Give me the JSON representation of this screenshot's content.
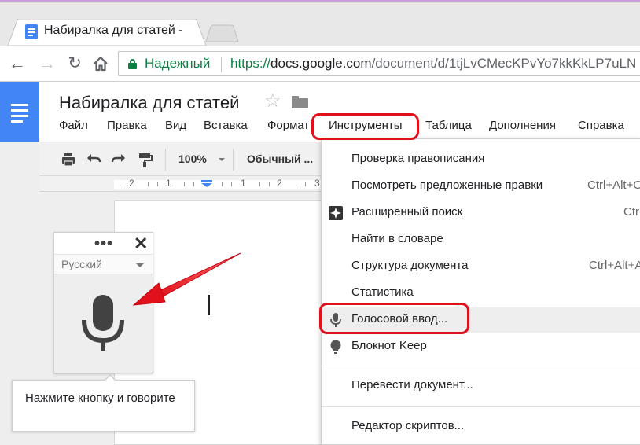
{
  "browser": {
    "tab_title": "Набиралка для статей -",
    "security_label": "Надежный",
    "url_scheme": "https://",
    "url_host": "docs.google.com",
    "url_path": "/document/d/1tjLvCMecKPvYo7kkKkLP7uLN"
  },
  "docs": {
    "title": "Набиралка для статей",
    "menu": [
      "Файл",
      "Правка",
      "Вид",
      "Вставка",
      "Формат",
      "Инструменты",
      "Таблица",
      "Дополнения",
      "Справка"
    ],
    "toolbar": {
      "zoom": "100%",
      "style": "Обычный ..."
    },
    "ruler": [
      "2",
      "1",
      "1",
      "2",
      "3"
    ]
  },
  "voice_widget": {
    "dots": "•••",
    "close": "✕",
    "language": "Русский",
    "hint": "Нажмите кнопку и говорите"
  },
  "tools_menu": {
    "items": [
      {
        "label": "Проверка правописания",
        "shortcut": "",
        "icon": ""
      },
      {
        "label": "Посмотреть предложенные правки",
        "shortcut": "Ctrl+Alt+O",
        "icon": ""
      },
      {
        "label": "Расширенный поиск",
        "shortcut": "Ctrl",
        "icon": "explore-icon"
      },
      {
        "label": "Найти в словаре",
        "shortcut": "",
        "icon": ""
      },
      {
        "label": "Структура документа",
        "shortcut": "Ctrl+Alt+A",
        "icon": ""
      },
      {
        "label": "Статистика",
        "shortcut": "",
        "icon": ""
      },
      {
        "label": "Голосовой ввод...",
        "shortcut": "",
        "icon": "mic-icon"
      },
      {
        "label": "Блокнот Keep",
        "shortcut": "",
        "icon": "keep-bulb-icon"
      },
      {
        "label": "Перевести документ...",
        "shortcut": "",
        "icon": ""
      },
      {
        "label": "Редактор скриптов...",
        "shortcut": "",
        "icon": ""
      }
    ]
  },
  "colors": {
    "docs_blue": "#4285f4",
    "secure_green": "#0b8043",
    "annotation_red": "#e0111b"
  }
}
